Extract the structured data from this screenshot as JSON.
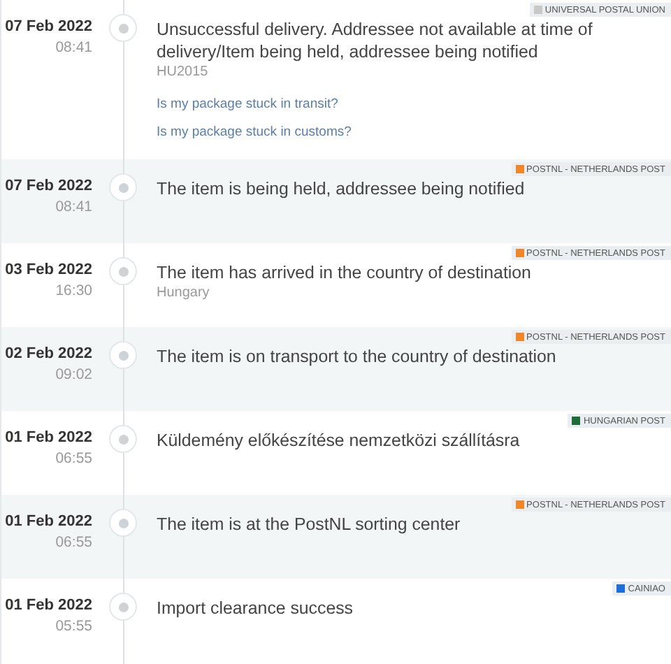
{
  "events": [
    {
      "date": "07 Feb 2022",
      "time": "08:41",
      "description": "Unsuccessful delivery. Addressee not available at time of delivery/Item being held, addressee being notified",
      "detail": "HU2015",
      "links": [
        "Is my package stuck in transit?",
        "Is my package stuck in customs?"
      ],
      "carrier": {
        "name": "UNIVERSAL POSTAL UNION",
        "color": "#c8c8c8"
      }
    },
    {
      "date": "07 Feb 2022",
      "time": "08:41",
      "description": "The item is being held, addressee being notified",
      "carrier": {
        "name": "POSTNL - NETHERLANDS POST",
        "color": "#f0862a"
      }
    },
    {
      "date": "03 Feb 2022",
      "time": "16:30",
      "description": "The item has arrived in the country of destination",
      "detail": "Hungary",
      "carrier": {
        "name": "POSTNL - NETHERLANDS POST",
        "color": "#f0862a"
      }
    },
    {
      "date": "02 Feb 2022",
      "time": "09:02",
      "description": "The item is on transport to the country of destination",
      "carrier": {
        "name": "POSTNL - NETHERLANDS POST",
        "color": "#f0862a"
      }
    },
    {
      "date": "01 Feb 2022",
      "time": "06:55",
      "description": "Küldemény előkészítése nemzetközi szállításra",
      "carrier": {
        "name": "HUNGARIAN POST",
        "color": "#1f6b3c"
      }
    },
    {
      "date": "01 Feb 2022",
      "time": "06:55",
      "description": "The item is at the PostNL sorting center",
      "carrier": {
        "name": "POSTNL - NETHERLANDS POST",
        "color": "#f0862a"
      }
    },
    {
      "date": "01 Feb 2022",
      "time": "05:55",
      "description": "Import clearance success",
      "carrier": {
        "name": "CAINIAO",
        "color": "#1c6fd6"
      }
    }
  ]
}
